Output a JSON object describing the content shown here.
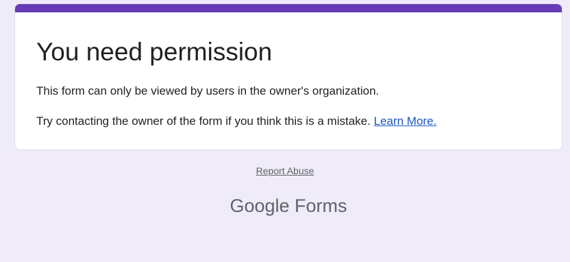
{
  "card": {
    "accent_color": "#673ab7",
    "title": "You need permission",
    "message_1": "This form can only be viewed by users in the owner's organization.",
    "message_2": "Try contacting the owner of the form if you think this is a mistake.",
    "learn_more_label": "Learn More."
  },
  "footer": {
    "report_abuse_label": "Report Abuse",
    "brand_google": "Google",
    "brand_product": "Forms"
  }
}
